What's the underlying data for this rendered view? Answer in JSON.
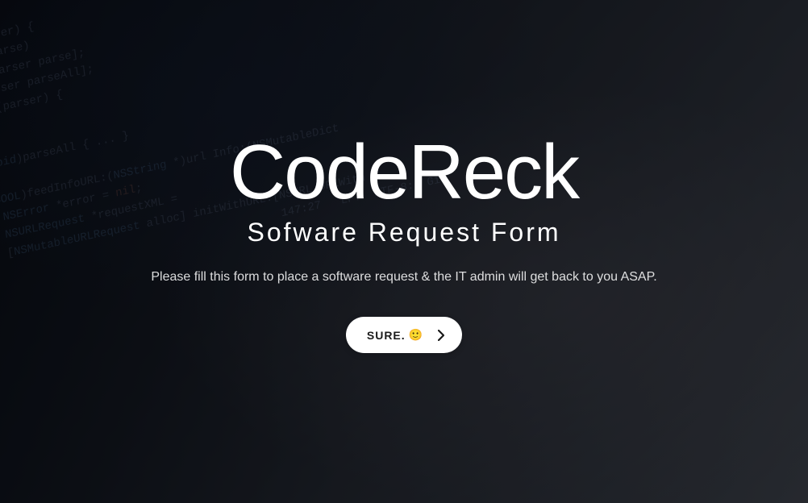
{
  "hero": {
    "title": "CodeReck",
    "subtitle": "Sofware Request Form",
    "description": "Please fill this form to place a software request & the IT admin will get back to you ASAP."
  },
  "cta": {
    "label": "SURE.",
    "emoji": "🙂"
  }
}
